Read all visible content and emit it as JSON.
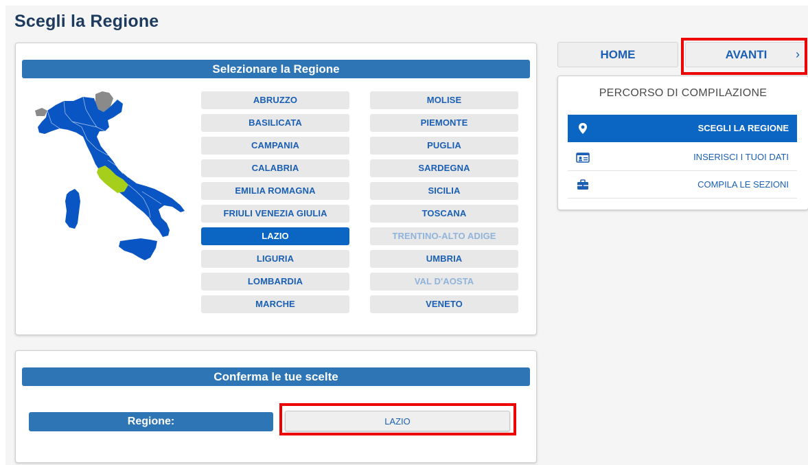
{
  "page": {
    "title": "Scegli la Regione"
  },
  "region_panel": {
    "header": "Selezionare la Regione",
    "regions_left": [
      {
        "label": "ABRUZZO",
        "state": "normal"
      },
      {
        "label": "BASILICATA",
        "state": "normal"
      },
      {
        "label": "CAMPANIA",
        "state": "normal"
      },
      {
        "label": "CALABRIA",
        "state": "normal"
      },
      {
        "label": "EMILIA ROMAGNA",
        "state": "normal"
      },
      {
        "label": "FRIULI VENEZIA GIULIA",
        "state": "normal"
      },
      {
        "label": "LAZIO",
        "state": "selected"
      },
      {
        "label": "LIGURIA",
        "state": "normal"
      },
      {
        "label": "LOMBARDIA",
        "state": "normal"
      },
      {
        "label": "MARCHE",
        "state": "normal"
      }
    ],
    "regions_right": [
      {
        "label": "MOLISE",
        "state": "normal"
      },
      {
        "label": "PIEMONTE",
        "state": "normal"
      },
      {
        "label": "PUGLIA",
        "state": "normal"
      },
      {
        "label": "SARDEGNA",
        "state": "normal"
      },
      {
        "label": "SICILIA",
        "state": "normal"
      },
      {
        "label": "TOSCANA",
        "state": "normal"
      },
      {
        "label": "TRENTINO-ALTO ADIGE",
        "state": "disabled"
      },
      {
        "label": "UMBRIA",
        "state": "normal"
      },
      {
        "label": "VAL D'AOSTA",
        "state": "disabled"
      },
      {
        "label": "VENETO",
        "state": "normal"
      }
    ],
    "map": {
      "selected_region": "LAZIO",
      "colors": {
        "region": "#0a55c4",
        "selected": "#a6cf1c",
        "disabled": "#8a8a8a"
      }
    }
  },
  "confirm_panel": {
    "header": "Conferma le tue scelte",
    "field_label": "Regione:",
    "field_value": "LAZIO"
  },
  "nav": {
    "home_label": "HOME",
    "next_label": "AVANTI",
    "next_icon": "chevron-right-icon"
  },
  "path": {
    "title": "PERCORSO DI COMPILAZIONE",
    "steps": [
      {
        "label": "SCEGLI LA REGIONE",
        "icon": "map-pin-icon",
        "active": true
      },
      {
        "label": "INSERISCI I TUOI DATI",
        "icon": "id-card-icon",
        "active": false
      },
      {
        "label": "COMPILA LE SEZIONI",
        "icon": "briefcase-icon",
        "active": false
      }
    ]
  },
  "colors": {
    "accent": "#2e75b6",
    "selected": "#0a66c2",
    "link": "#1a5fb4",
    "highlight": "#ee0000",
    "title": "#1d3a5f"
  }
}
